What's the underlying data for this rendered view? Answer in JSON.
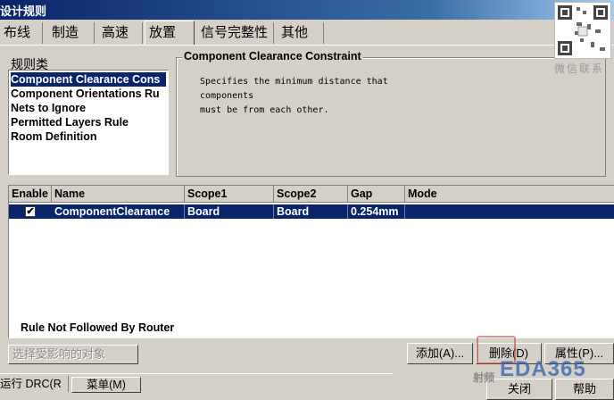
{
  "window": {
    "title": "设计规则"
  },
  "tabs": [
    {
      "label": "布线"
    },
    {
      "label": "制造"
    },
    {
      "label": "高速"
    },
    {
      "label": "放置",
      "active": true
    },
    {
      "label": "信号完整性"
    },
    {
      "label": "其他"
    }
  ],
  "rule_classes": {
    "label": "规则类",
    "items": [
      {
        "label": "Component Clearance Cons",
        "selected": true
      },
      {
        "label": "Component Orientations Ru"
      },
      {
        "label": "Nets to Ignore"
      },
      {
        "label": "Permitted Layers Rule"
      },
      {
        "label": "Room Definition"
      }
    ]
  },
  "description": {
    "title": "Component Clearance Constraint",
    "lines": [
      "Specifies the minimum distance that",
      "components",
      "must be from each other."
    ]
  },
  "grid": {
    "columns": [
      "Enable",
      "Name",
      "Scope1",
      "Scope2",
      "Gap",
      "Mode"
    ],
    "rows": [
      {
        "enabled": true,
        "name": "ComponentClearance",
        "scope1": "Board",
        "scope2": "Board",
        "gap": "0.254mm",
        "mode": ""
      }
    ],
    "footer_note": "Rule Not Followed By Router"
  },
  "buttons": {
    "select_affected": "选择受影响的对象",
    "add": "添加(A)...",
    "delete": "删除(D)",
    "properties": "属性(P)...",
    "close": "关闭",
    "help": "帮助"
  },
  "taskbar": {
    "run": "运行 DRC(R",
    "menu": "菜单(M)"
  },
  "watermark": {
    "qr_caption": "微信联系",
    "brand": "EDA365",
    "brand_sub": "射频"
  },
  "colors": {
    "selection": "#0a246a",
    "face": "#d4d0c8",
    "watermark_red": "#c0392b",
    "watermark_blue": "#2f5fb3"
  }
}
